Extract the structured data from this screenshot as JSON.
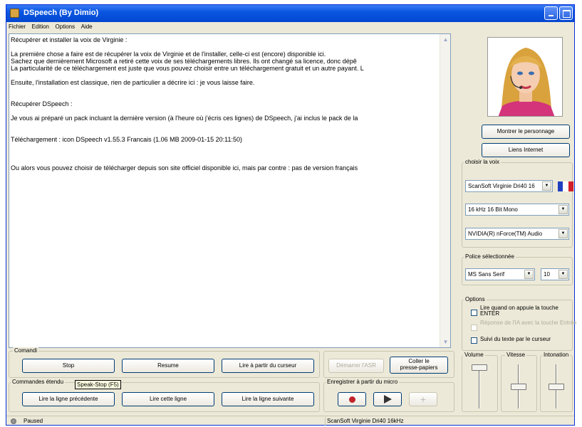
{
  "window": {
    "title": "DSpeech (By Dimio)"
  },
  "menu": [
    "Fichier",
    "Edition",
    "Options",
    "Aide"
  ],
  "document": {
    "lines": [
      "Récupérer et installer la voix de Virginie :",
      "",
      "La première chose a faire est de récupérer la voix de Virginie et de l'installer, celle-ci est (encore) disponible ici.",
      "Sachez que dernièrement Microsoft a retiré cette voix de ses téléchargements libres. Ils ont changé sa licence, donc dépê",
      "La particularité de ce téléchargement est juste que vous pouvez choisir entre un téléchargement gratuit et un autre payant. L",
      "",
      "Ensuite, l'installation est classique, rien de particulier a décrire ici : je vous laisse faire.",
      "",
      "",
      "Récupérer DSpeech :",
      "",
      "Je vous ai préparé un pack incluant la dernière version (à l'heure où j'écris ces lignes) de DSpeech, j'ai inclus le pack de la",
      "",
      "",
      "Téléchargement : icon DSpeech v1.55.3 Francais (1.06 MB 2009-01-15 20:11:50)",
      "",
      "",
      "",
      "Ou alors vous pouvez choisir de télécharger depuis son site officiel disponible ici, mais par contre : pas de version français"
    ]
  },
  "comandi": {
    "label": "Comandi",
    "stop": "Stop",
    "resume": "Resume",
    "lire_curseur": "Lire à partir du curseur"
  },
  "asr": {
    "demarrer": "Démarrer l'ASR",
    "coller_1": "Coller le",
    "coller_2": "presse-papiers"
  },
  "commandes_etendues": {
    "label": "Commandes étendu",
    "tooltip": "Speak-Stop (F5)",
    "precedente": "Lire la ligne précédente",
    "cette": "Lire cette ligne",
    "suivante": "Lire la ligne suivante"
  },
  "micro": {
    "label": "Enregistrer à partir du micro"
  },
  "status": {
    "state": "Paused",
    "voice": "ScanSoft Virginie Dri40 16kHz"
  },
  "character": {
    "show": "Montrer le personnage",
    "links": "Liens Internet"
  },
  "voice": {
    "label": "choisir la voix",
    "engine": "ScanSoft Virginie Dri40 16",
    "format": "16 kHz 16 Bit Mono",
    "device": "NVIDIA(R) nForce(TM) Audio",
    "flag_colors": [
      "#1f3fbf",
      "#ffffff",
      "#d0202a"
    ]
  },
  "font": {
    "label": "Police sélectionnée",
    "family": "MS Sans Serif",
    "size": "10"
  },
  "options": {
    "label": "Options",
    "opt1": "Lire quand on appuie la touche ENTER",
    "opt2": "Réponse de l'IA avec la touche Entrée",
    "opt3": "Suivi du texte par le curseur"
  },
  "sliders": {
    "volume_label": "Volume",
    "vitesse_label": "Vitesse",
    "intonation_label": "Intonation",
    "volume": 1.0,
    "vitesse": 0.5,
    "intonation": 0.5
  }
}
